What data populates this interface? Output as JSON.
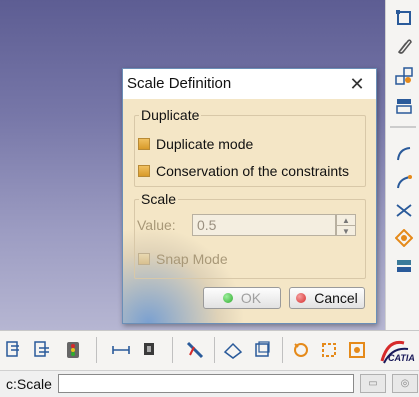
{
  "dialog": {
    "title": "Scale Definition",
    "close_glyph": "✕",
    "duplicate_group": {
      "legend": "Duplicate",
      "duplicate_mode_label": "Duplicate mode",
      "conservation_label": "Conservation of the constraints"
    },
    "scale_group": {
      "legend": "Scale",
      "value_label": "Value:",
      "value": "0.5",
      "snap_mode_label": "Snap Mode"
    },
    "ok_label": "OK",
    "cancel_label": "Cancel",
    "ok_dot_color": "#2eaa2e",
    "cancel_dot_color": "#d62a2a"
  },
  "status": {
    "label": "c:Scale",
    "command_value": ""
  },
  "branding": {
    "logo_text": "CATIA"
  },
  "right_toolbar": {
    "icons": [
      "frame-icon",
      "paperclip-icon",
      "transform-icon",
      "stack-icon",
      "arc-icon",
      "arc-icon-2",
      "cross-lines-icon",
      "orange-shape-icon",
      "layers-icon"
    ]
  },
  "bottom_toolbar": {
    "icons": [
      "sketch-tool-icon",
      "sketch-tool-2-icon",
      "traffic-light-icon",
      "measure-icon",
      "pin-icon",
      "paint-icon",
      "grid-dropdown-icon",
      "box-dropdown-icon",
      "orange-constraint-icon",
      "orange-constraint-2-icon",
      "orange-constraint-3-icon"
    ]
  },
  "colors": {
    "background_top": "#5d5d93",
    "dialog_client": "#f4e6c6",
    "accent_orange": "#e58a1a"
  }
}
